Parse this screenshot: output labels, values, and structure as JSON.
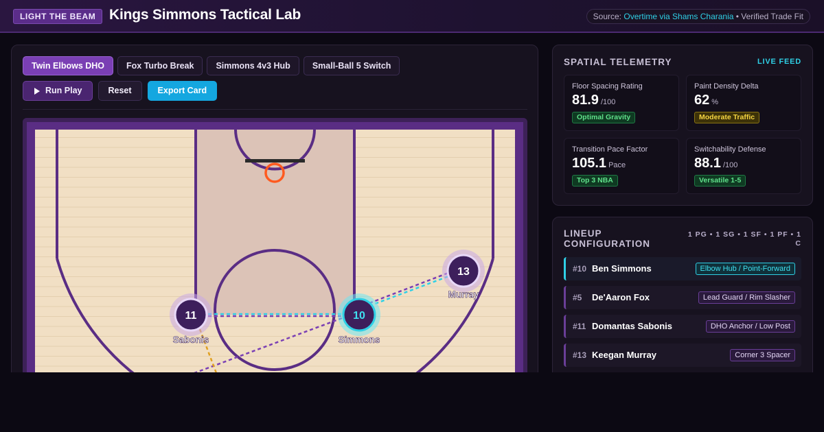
{
  "header": {
    "badge": "LIGHT THE BEAM",
    "title": "Kings Simmons Tactical Lab",
    "source_prefix": "Source: ",
    "source_link": "Overtime via Shams Charania",
    "source_suffix": " • Verified Trade Fit"
  },
  "plays": {
    "tabs": [
      {
        "label": "Twin Elbows DHO",
        "active": true
      },
      {
        "label": "Fox Turbo Break",
        "active": false
      },
      {
        "label": "Simmons 4v3 Hub",
        "active": false
      },
      {
        "label": "Small-Ball 5 Switch",
        "active": false
      }
    ],
    "run_label": "Run Play",
    "reset_label": "Reset",
    "export_label": "Export Card"
  },
  "court": {
    "players": [
      {
        "number": "11",
        "name": "Sabonis",
        "highlight": false
      },
      {
        "number": "10",
        "name": "Simmons",
        "highlight": true
      },
      {
        "number": "13",
        "name": "Murray",
        "highlight": false
      }
    ]
  },
  "telemetry": {
    "title": "SPATIAL TELEMETRY",
    "live_label": "LIVE FEED",
    "metrics": [
      {
        "label": "Floor Spacing Rating",
        "value": "81.9",
        "unit": "/100",
        "tag": "Optimal Gravity",
        "tag_color": "green"
      },
      {
        "label": "Paint Density Delta",
        "value": "62",
        "unit": "%",
        "tag": "Moderate Traffic",
        "tag_color": "yellow"
      },
      {
        "label": "Transition Pace Factor",
        "value": "105.1",
        "unit": "Pace",
        "tag": "Top 3 NBA",
        "tag_color": "green"
      },
      {
        "label": "Switchability Defense",
        "value": "88.1",
        "unit": "/100",
        "tag": "Versatile 1-5",
        "tag_color": "green"
      }
    ]
  },
  "lineup": {
    "title": "LINEUP CONFIGURATION",
    "positions": "1 PG • 1 SG • 1 SF • 1 PF • 1 C",
    "players": [
      {
        "number": "#10",
        "name": "Ben Simmons",
        "role": "Elbow Hub / Point-Forward",
        "active": true
      },
      {
        "number": "#5",
        "name": "De'Aaron Fox",
        "role": "Lead Guard / Rim Slasher",
        "active": false
      },
      {
        "number": "#11",
        "name": "Domantas Sabonis",
        "role": "DHO Anchor / Low Post",
        "active": false
      },
      {
        "number": "#13",
        "name": "Keegan Murray",
        "role": "Corner 3 Spacer",
        "active": false
      }
    ]
  },
  "colors": {
    "accent_purple": "#7a3fb4",
    "accent_cyan": "#2fd0e6",
    "court_wood": "#f1dfc4",
    "court_line": "#5a2d84",
    "rim_orange": "#ff5a1f"
  }
}
